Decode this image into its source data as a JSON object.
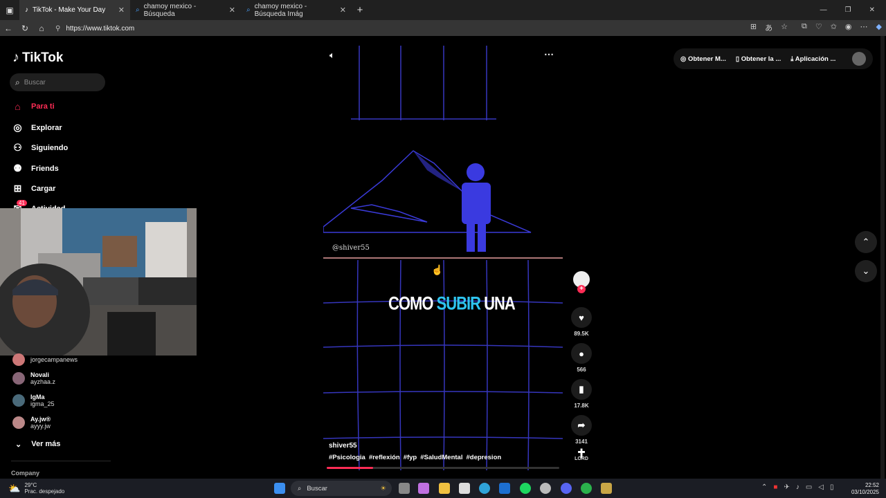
{
  "browser": {
    "tabs": [
      {
        "title": "TikTok - Make Your Day",
        "active": true
      },
      {
        "title": "chamoy mexico - Búsqueda",
        "active": false
      },
      {
        "title": "chamoy mexico - Búsqueda Imág",
        "active": false
      }
    ],
    "url": "https://www.tiktok.com"
  },
  "sidebar": {
    "logo": "TikTok",
    "search_placeholder": "Buscar",
    "nav": [
      {
        "label": "Para ti",
        "icon": "home-icon",
        "active": true
      },
      {
        "label": "Explorar",
        "icon": "compass-icon"
      },
      {
        "label": "Siguiendo",
        "icon": "following-icon"
      },
      {
        "label": "Friends",
        "icon": "friends-icon"
      },
      {
        "label": "Cargar",
        "icon": "upload-icon"
      },
      {
        "label": "Actividad",
        "icon": "activity-icon",
        "badge": "41"
      }
    ],
    "following_accounts": [
      {
        "name": "",
        "handle": "jorgecampanews",
        "color": "#c77"
      },
      {
        "name": "Novali",
        "handle": "ayzhaa.z",
        "color": "#867"
      },
      {
        "name": "IgMa",
        "handle": "igma_25",
        "color": "#4a6a7a"
      },
      {
        "name": "Ay.jw®",
        "handle": "ayyy.jw",
        "color": "#b88"
      }
    ],
    "see_more": "Ver más",
    "company": "Company"
  },
  "header": {
    "get_coins": "Obtener M...",
    "get_app": "Obtener la ...",
    "desktop_app": "Aplicación ..."
  },
  "video": {
    "watermark": "@shiver55",
    "overlay_text": {
      "part1": "COMO ",
      "highlight": "SUBIR",
      "part2": " UNA"
    },
    "author": "shiver55",
    "hashtags": [
      "#Psicologia",
      "#reflexión",
      "#fyp",
      "#SaludMental",
      "#depresion"
    ],
    "progress": 0.2
  },
  "actions": {
    "likes": "89.5K",
    "comments": "566",
    "saves": "17.8K",
    "shares": "3141",
    "music_label": "LORD"
  },
  "taskbar": {
    "temp": "29°C",
    "weather": "Prac. despejado",
    "search": "Buscar",
    "time": "22:52",
    "date": "03/10/2025"
  }
}
